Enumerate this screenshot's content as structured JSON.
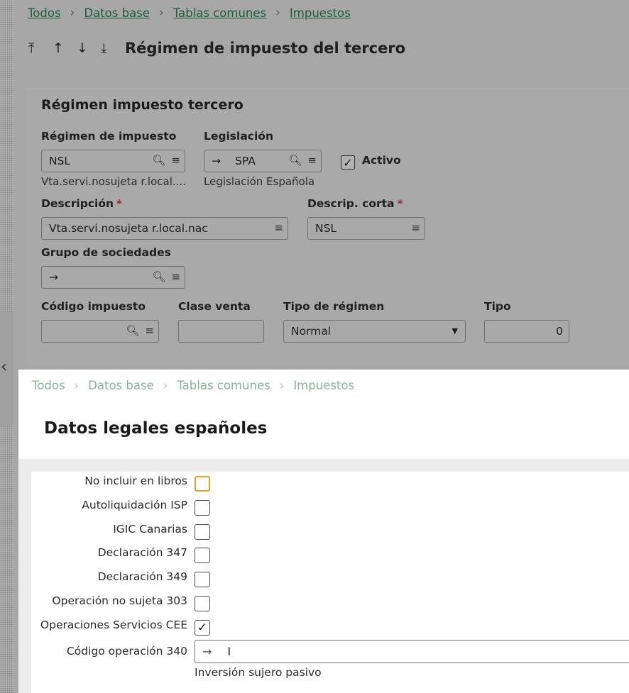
{
  "breadcrumb": [
    "Todos",
    "Datos base",
    "Tablas comunes",
    "Impuestos"
  ],
  "nav_arrows": [
    "⤒",
    "↑",
    "↓",
    "⤓"
  ],
  "page_title": "Régimen de impuesto del tercero",
  "panel": {
    "title": "Régimen impuesto tercero",
    "regimen": {
      "label": "Régimen de impuesto",
      "value": "NSL",
      "desc": "Vta.servi.nosujeta r.local...."
    },
    "legislacion": {
      "label": "Legislación",
      "value": "SPA",
      "desc": "Legislación Española"
    },
    "activo": {
      "label": "Activo",
      "checked": true
    },
    "descripcion": {
      "label": "Descripción",
      "value": "Vta.servi.nosujeta r.local.nac"
    },
    "descrip_corta": {
      "label": "Descrip. corta",
      "value": "NSL"
    },
    "grupo": {
      "label": "Grupo de sociedades",
      "value": ""
    },
    "codigo_impuesto": {
      "label": "Código impuesto",
      "value": ""
    },
    "clase_venta": {
      "label": "Clase venta",
      "value": ""
    },
    "tipo_regimen": {
      "label": "Tipo de régimen",
      "value": "Normal"
    },
    "tipo": {
      "label": "Tipo",
      "value": "0"
    }
  },
  "modal": {
    "breadcrumb": [
      "Todos",
      "Datos base",
      "Tablas comunes",
      "Impuestos"
    ],
    "title": "Datos legales españoles",
    "rows": [
      {
        "label": "No incluir en libros",
        "checked": false,
        "focused": true
      },
      {
        "label": "Autoliquidación ISP",
        "checked": false
      },
      {
        "label": "IGIC Canarias",
        "checked": false
      },
      {
        "label": "Declaración 347",
        "checked": false
      },
      {
        "label": "Declaración 349",
        "checked": false
      },
      {
        "label": "Operación no sujeta 303",
        "checked": false
      },
      {
        "label": "Operaciones Servicios CEE",
        "checked": true
      }
    ],
    "codigo340": {
      "label": "Código operación 340",
      "value": "I",
      "desc": "Inversión sujero pasivo"
    }
  }
}
